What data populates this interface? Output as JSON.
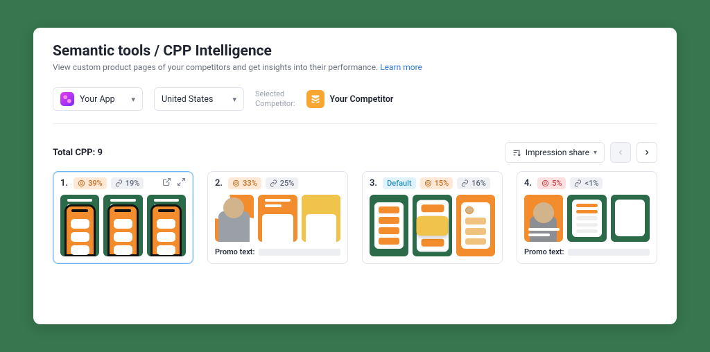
{
  "header": {
    "breadcrumb_parent": "Semantic tools",
    "breadcrumb_sep": " / ",
    "breadcrumb_current": "CPP Intelligence",
    "subtitle": "View custom product pages of your competitors and get insights into their performance. ",
    "learn_more": "Learn more"
  },
  "filters": {
    "app_label": "Your App",
    "country_label": "United States",
    "selected_label_l1": "Selected",
    "selected_label_l2": "Competitor:",
    "competitor_name": "Your Competitor"
  },
  "toolbar": {
    "total_label": "Total CPP: 9",
    "sort_label": "Impression share"
  },
  "cards": [
    {
      "rank": "1.",
      "impression_badge": "39%",
      "impression_color": "orange",
      "link_badge": "19%",
      "default": false,
      "promo": false,
      "active": true,
      "tools": true
    },
    {
      "rank": "2.",
      "impression_badge": "33%",
      "impression_color": "orange",
      "link_badge": "25%",
      "default": false,
      "promo": true,
      "promo_label": "Promo text:",
      "active": false,
      "tools": false
    },
    {
      "rank": "3.",
      "default": true,
      "default_label": "Default",
      "impression_badge": "15%",
      "impression_color": "orange",
      "link_badge": "16%",
      "promo": false,
      "active": false,
      "tools": false
    },
    {
      "rank": "4.",
      "impression_badge": "5%",
      "impression_color": "red",
      "link_badge": "<1%",
      "default": false,
      "promo": true,
      "promo_label": "Promo text:",
      "active": false,
      "tools": false
    }
  ]
}
